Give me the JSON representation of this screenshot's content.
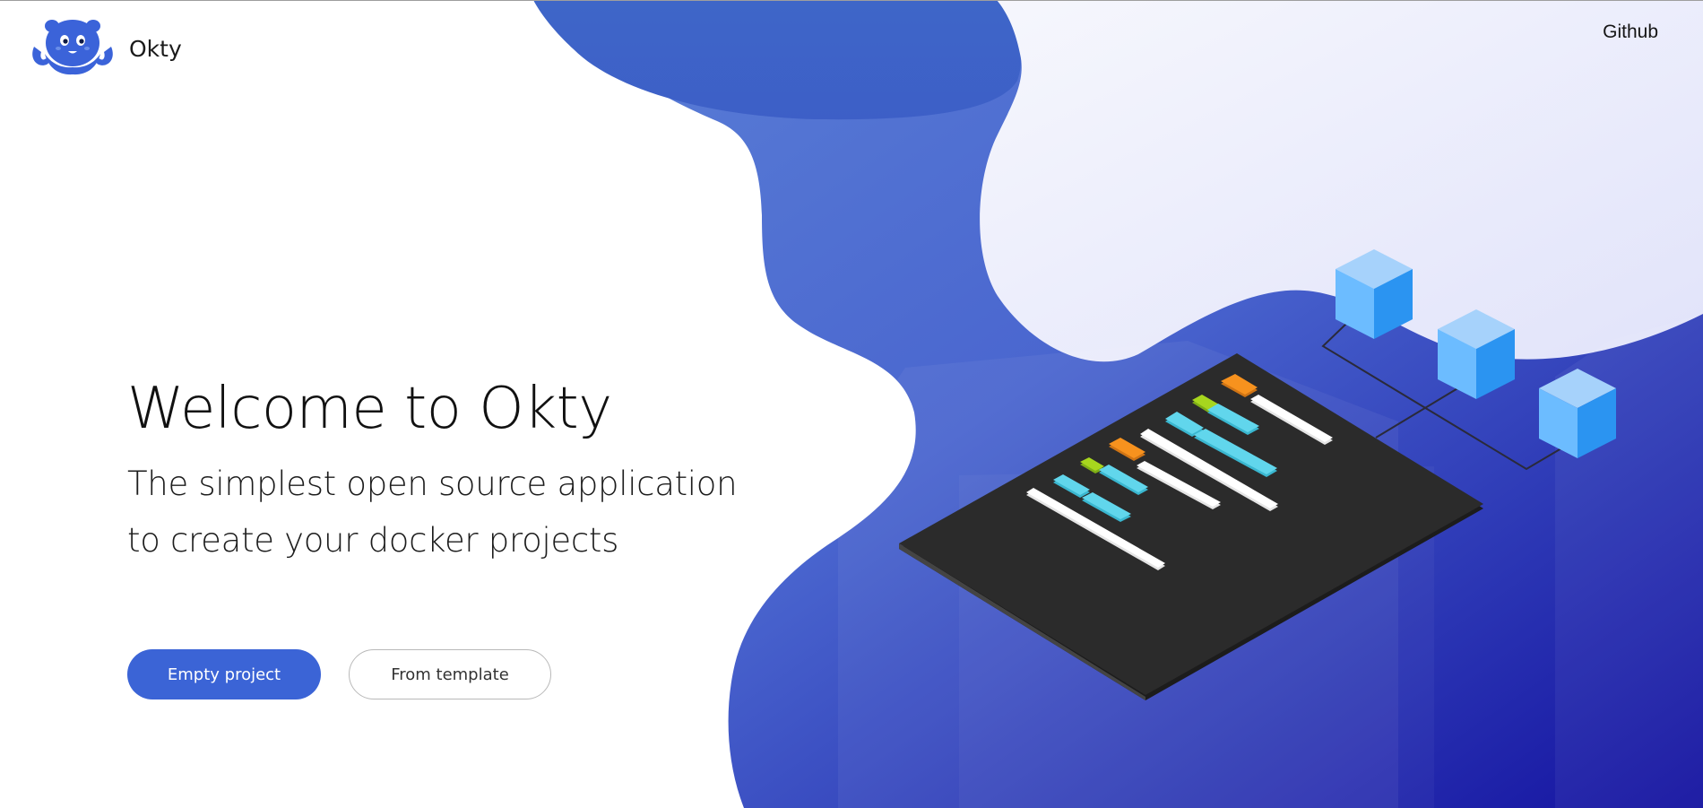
{
  "brand": {
    "name": "Okty",
    "logo_icon": "octopus-logo-icon",
    "logo_color": "#3b63d9"
  },
  "nav": {
    "github_label": "Github"
  },
  "hero": {
    "title": "Welcome to Okty",
    "subtitle_line1": "The simplest open source application",
    "subtitle_line2": "to create your docker projects"
  },
  "actions": {
    "empty_project_label": "Empty project",
    "from_template_label": "From template"
  },
  "illustration": {
    "name": "isometric-code-board-illustration",
    "cube_count": 3
  },
  "colors": {
    "accent": "#3b64d6",
    "blob_dark": "#1412a0",
    "blob_light": "#5a7fd6",
    "lilac": "#e3e4fa",
    "board": "#2b2b2b",
    "code_cyan": "#61d6ec",
    "code_orange": "#f7921e",
    "code_green": "#a7d61e",
    "cube_blue": "#2b94f1"
  }
}
